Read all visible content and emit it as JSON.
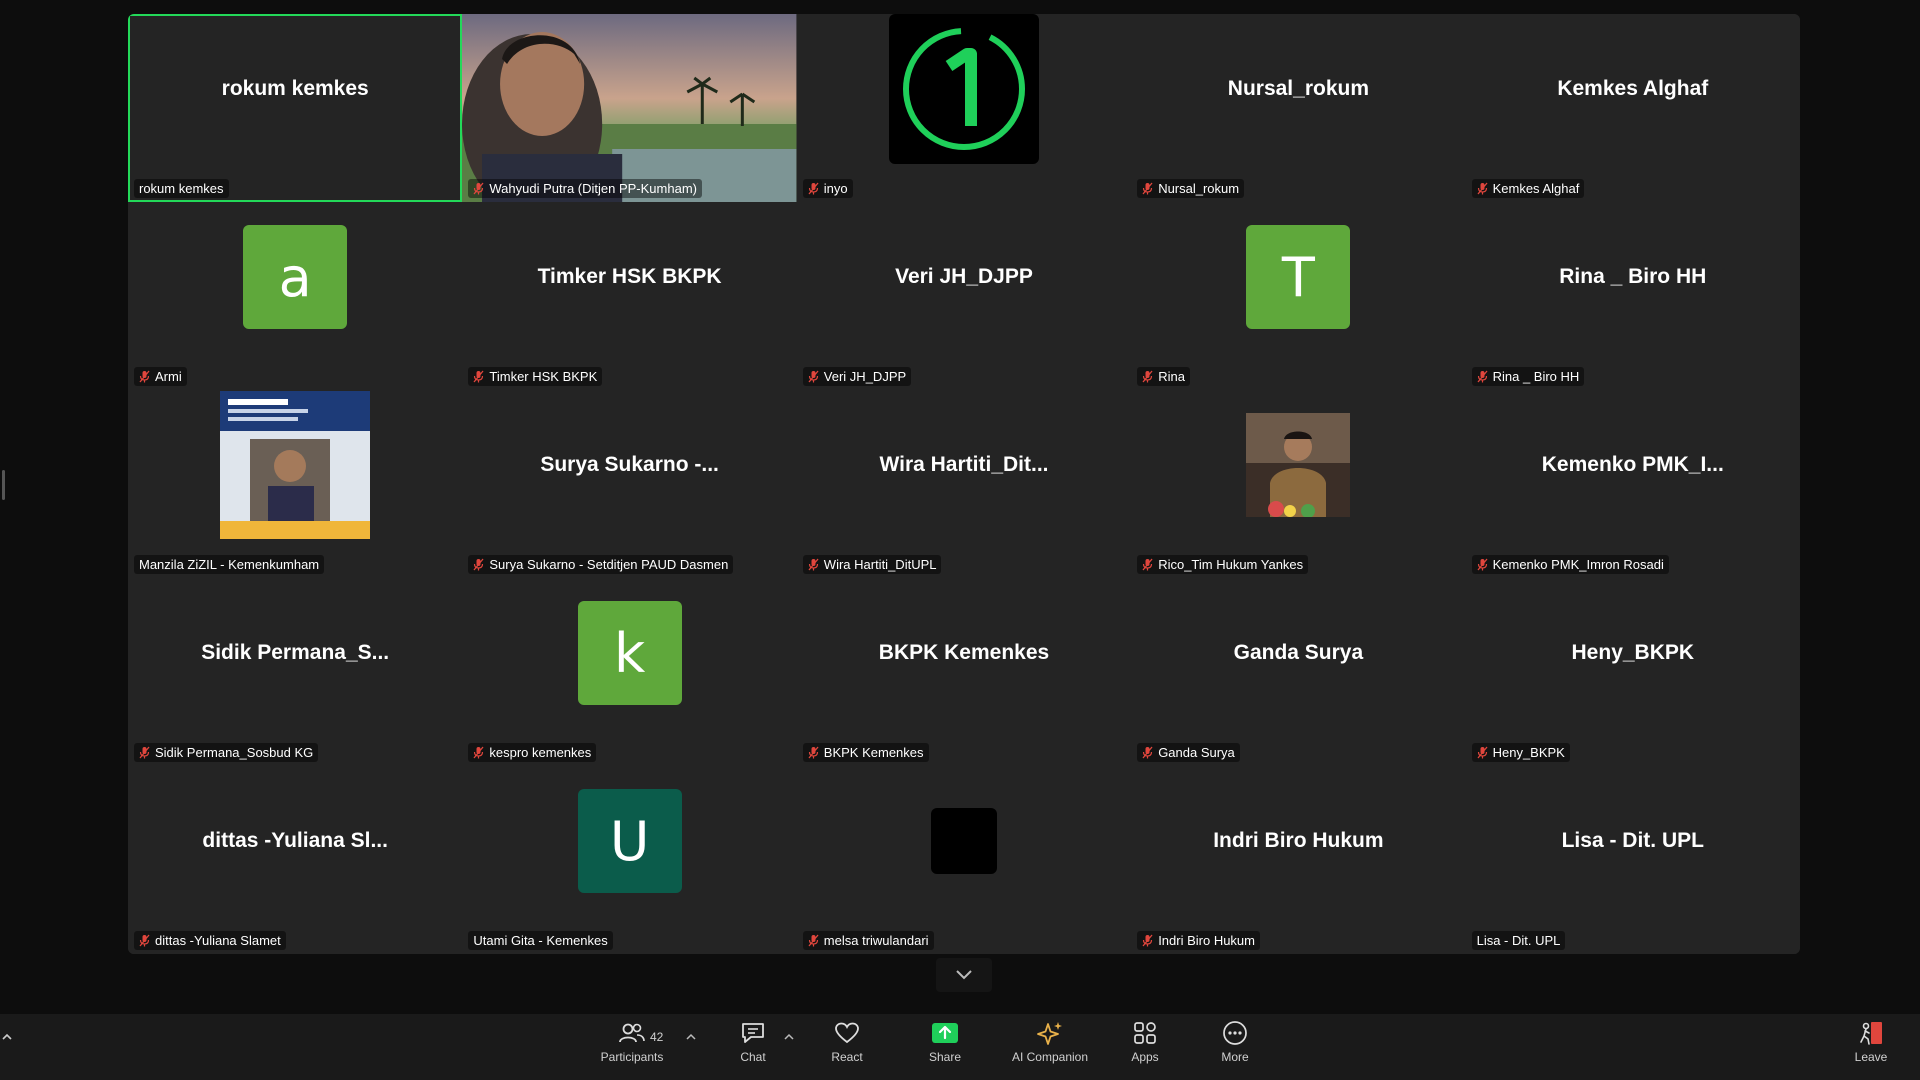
{
  "participants": [
    {
      "center": "rokum kemkes",
      "label": "rokum kemkes",
      "muted": false,
      "active": true,
      "kind": "name"
    },
    {
      "center": "",
      "label": "Wahyudi Putra (Ditjen PP-Kumham)",
      "muted": true,
      "kind": "photo-landscape"
    },
    {
      "center": "",
      "label": "inyo",
      "muted": true,
      "kind": "logo-one"
    },
    {
      "center": "Nursal_rokum",
      "label": "Nursal_rokum",
      "muted": true,
      "kind": "name"
    },
    {
      "center": "Kemkes Alghaf",
      "label": "Kemkes Alghaf",
      "muted": true,
      "kind": "name"
    },
    {
      "center": "a",
      "label": "Armi",
      "muted": true,
      "kind": "avatar",
      "color": "#5fa83b"
    },
    {
      "center": "Timker HSK BKPK",
      "label": "Timker HSK BKPK",
      "muted": true,
      "kind": "name"
    },
    {
      "center": "Veri JH_DJPP",
      "label": "Veri JH_DJPP",
      "muted": true,
      "kind": "name"
    },
    {
      "center": "T",
      "label": "Rina",
      "muted": true,
      "kind": "avatar",
      "color": "#5fa83b"
    },
    {
      "center": "Rina _ Biro HH",
      "label": "Rina _ Biro HH",
      "muted": true,
      "kind": "name"
    },
    {
      "center": "",
      "label": "Manzila ZiZIL - Kemenkumham",
      "muted": false,
      "kind": "photo-poster"
    },
    {
      "center": "Surya Sukarno -...",
      "label": "Surya Sukarno - Setditjen PAUD Dasmen",
      "muted": true,
      "kind": "name"
    },
    {
      "center": "Wira Hartiti_Dit...",
      "label": "Wira Hartiti_DitUPL",
      "muted": true,
      "kind": "name"
    },
    {
      "center": "",
      "label": "Rico_Tim Hukum Yankes",
      "muted": true,
      "kind": "photo-speaker"
    },
    {
      "center": "Kemenko PMK_I...",
      "label": "Kemenko PMK_Imron Rosadi",
      "muted": true,
      "kind": "name"
    },
    {
      "center": "Sidik Permana_S...",
      "label": "Sidik Permana_Sosbud KG",
      "muted": true,
      "kind": "name"
    },
    {
      "center": "k",
      "label": "kespro kemenkes",
      "muted": true,
      "kind": "avatar",
      "color": "#5fa83b"
    },
    {
      "center": "BKPK Kemenkes",
      "label": "BKPK Kemenkes",
      "muted": true,
      "kind": "name"
    },
    {
      "center": "Ganda Surya",
      "label": "Ganda Surya",
      "muted": true,
      "kind": "name"
    },
    {
      "center": "Heny_BKPK",
      "label": "Heny_BKPK",
      "muted": true,
      "kind": "name"
    },
    {
      "center": "dittas -Yuliana Sl...",
      "label": "dittas -Yuliana Slamet",
      "muted": true,
      "kind": "name"
    },
    {
      "center": "U",
      "label": "Utami Gita - Kemenkes",
      "muted": false,
      "kind": "avatar",
      "color": "#0b5c4b"
    },
    {
      "center": "",
      "label": "melsa triwulandari",
      "muted": true,
      "kind": "black-square"
    },
    {
      "center": "Indri Biro Hukum",
      "label": "Indri Biro Hukum",
      "muted": true,
      "kind": "name"
    },
    {
      "center": "Lisa - Dit. UPL",
      "label": "Lisa - Dit. UPL",
      "muted": false,
      "kind": "name"
    }
  ],
  "toolbar": {
    "participants_label": "Participants",
    "participants_count": "42",
    "chat_label": "Chat",
    "react_label": "React",
    "share_label": "Share",
    "ai_label": "AI Companion",
    "apps_label": "Apps",
    "more_label": "More",
    "leave_label": "Leave"
  },
  "colors": {
    "active_border": "#23d959",
    "share_green": "#1fcf5a",
    "mute_red": "#e0463d",
    "ai_gold": "#e8b14a"
  },
  "icons": {
    "participants": "people-icon",
    "chat": "chat-bubble-icon",
    "react": "heart-icon",
    "share": "share-screen-icon",
    "ai": "sparkle-icon",
    "apps": "apps-grid-icon",
    "more": "more-dots-icon",
    "leave": "leave-door-icon",
    "mute": "muted-mic-icon"
  }
}
